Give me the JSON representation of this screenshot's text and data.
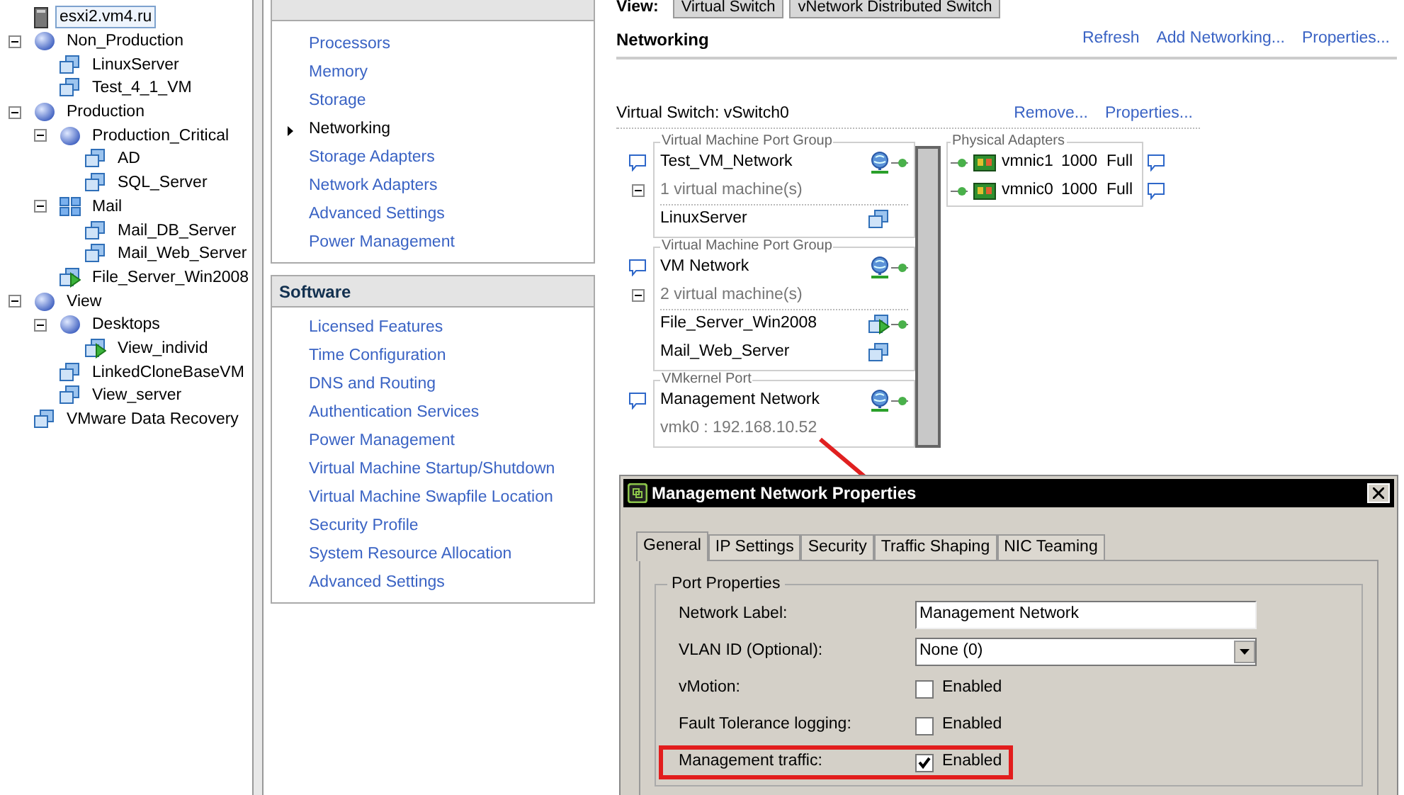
{
  "tree": [
    {
      "label": "esxi2.vm4.ru",
      "kind": "host",
      "selected": true
    },
    {
      "label": "Non_Production",
      "kind": "pool",
      "selected": false,
      "expanded": true,
      "children": [
        {
          "label": "LinuxServer",
          "kind": "vm",
          "selected": false
        },
        {
          "label": "Test_4_1_VM",
          "kind": "vm",
          "selected": false
        }
      ]
    },
    {
      "label": "Production",
      "kind": "pool",
      "selected": false,
      "expanded": true,
      "children": [
        {
          "label": "Production_Critical",
          "kind": "pool",
          "selected": false,
          "expanded": true,
          "children": [
            {
              "label": "AD",
              "kind": "vm",
              "selected": false
            },
            {
              "label": "SQL_Server",
              "kind": "vm",
              "selected": false
            }
          ]
        },
        {
          "label": "Mail",
          "kind": "vapp",
          "selected": false,
          "expanded": true,
          "children": [
            {
              "label": "Mail_DB_Server",
              "kind": "vm",
              "selected": false
            },
            {
              "label": "Mail_Web_Server",
              "kind": "vm",
              "selected": false
            }
          ]
        },
        {
          "label": "File_Server_Win2008",
          "kind": "vm_on",
          "selected": false
        }
      ]
    },
    {
      "label": "View",
      "kind": "pool",
      "selected": false,
      "expanded": true,
      "children": [
        {
          "label": "Desktops",
          "kind": "pool",
          "selected": false,
          "expanded": true,
          "children": [
            {
              "label": "View_individ",
              "kind": "vm_on",
              "selected": false
            }
          ]
        },
        {
          "label": "LinkedCloneBaseVM",
          "kind": "vm",
          "selected": false
        },
        {
          "label": "View_server",
          "kind": "vm",
          "selected": false
        }
      ]
    },
    {
      "label": "VMware Data Recovery",
      "kind": "vm",
      "selected": false
    }
  ],
  "hardware": {
    "items": [
      {
        "label": "Processors",
        "selected": false
      },
      {
        "label": "Memory",
        "selected": false
      },
      {
        "label": "Storage",
        "selected": false
      },
      {
        "label": "Networking",
        "selected": true
      },
      {
        "label": "Storage Adapters",
        "selected": false
      },
      {
        "label": "Network Adapters",
        "selected": false
      },
      {
        "label": "Advanced Settings",
        "selected": false
      },
      {
        "label": "Power Management",
        "selected": false
      }
    ]
  },
  "software": {
    "title": "Software",
    "items": [
      {
        "label": "Licensed Features",
        "selected": false
      },
      {
        "label": "Time Configuration",
        "selected": false
      },
      {
        "label": "DNS and Routing",
        "selected": false
      },
      {
        "label": "Authentication Services",
        "selected": false
      },
      {
        "label": "Power Management",
        "selected": false
      },
      {
        "label": "Virtual Machine Startup/Shutdown",
        "selected": false
      },
      {
        "label": "Virtual Machine Swapfile Location",
        "selected": false
      },
      {
        "label": "Security Profile",
        "selected": false
      },
      {
        "label": "System Resource Allocation",
        "selected": false
      },
      {
        "label": "Advanced Settings",
        "selected": false
      }
    ]
  },
  "view": {
    "label": "View:",
    "options": [
      "Virtual Switch",
      "vNetwork Distributed Switch"
    ]
  },
  "networking": {
    "title": "Networking",
    "links": [
      "Refresh",
      "Add Networking...",
      "Properties..."
    ]
  },
  "vswitch": {
    "title": "Virtual Switch: vSwitch0",
    "links": [
      "Remove...",
      "Properties..."
    ],
    "port_groups": [
      {
        "kind": "vm",
        "header": "Virtual Machine Port Group",
        "name": "Test_VM_Network",
        "count": "1 virtual machine(s)",
        "expanded": true,
        "vms": [
          {
            "name": "LinuxServer",
            "kind": "vm"
          }
        ]
      },
      {
        "kind": "vm",
        "header": "Virtual Machine Port Group",
        "name": "VM Network",
        "count": "2 virtual machine(s)",
        "expanded": true,
        "vms": [
          {
            "name": "File_Server_Win2008",
            "kind": "vm_on"
          },
          {
            "name": "Mail_Web_Server",
            "kind": "vm"
          }
        ]
      },
      {
        "kind": "vmkernel",
        "header": "VMkernel Port",
        "name": "Management Network",
        "detail": "vmk0 : 192.168.10.52"
      }
    ],
    "physical": {
      "header": "Physical Adapters",
      "adapters": [
        {
          "name": "vmnic1",
          "speed": "1000",
          "duplex": "Full"
        },
        {
          "name": "vmnic0",
          "speed": "1000",
          "duplex": "Full"
        }
      ]
    }
  },
  "dialog": {
    "title": "Management Network Properties",
    "tabs": [
      {
        "label": "General",
        "selected": true
      },
      {
        "label": "IP Settings",
        "selected": false
      },
      {
        "label": "Security",
        "selected": false
      },
      {
        "label": "Traffic Shaping",
        "selected": false
      },
      {
        "label": "NIC Teaming",
        "selected": false
      }
    ],
    "group": "Port Properties",
    "fields": [
      {
        "kind": "text",
        "label": "Network Label:",
        "value": "Management Network"
      },
      {
        "kind": "select",
        "label": "VLAN ID (Optional):",
        "value": "None (0)"
      },
      {
        "kind": "checkbox",
        "label": "vMotion:",
        "text": "Enabled",
        "checked": false,
        "highlighted": false
      },
      {
        "kind": "checkbox",
        "label": "Fault Tolerance logging:",
        "text": "Enabled",
        "checked": false,
        "highlighted": false
      },
      {
        "kind": "checkbox",
        "label": "Management traffic:",
        "text": "Enabled",
        "checked": true,
        "highlighted": true
      }
    ]
  }
}
